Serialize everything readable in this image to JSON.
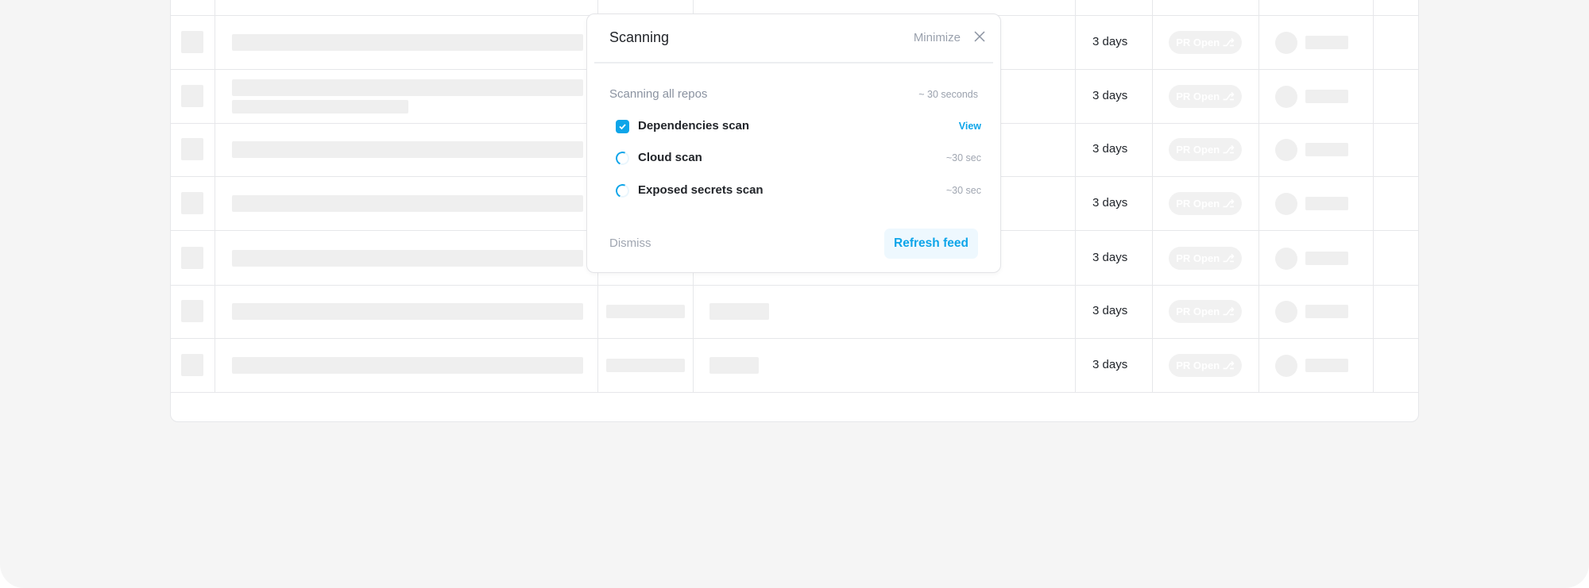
{
  "table": {
    "rows": [
      {
        "age": "3 days",
        "status": "PR Open ⎇"
      },
      {
        "age": "3 days",
        "status": "PR Open ⎇"
      },
      {
        "age": "3 days",
        "status": "PR Open ⎇"
      },
      {
        "age": "3 days",
        "status": "PR Open ⎇"
      },
      {
        "age": "3 days",
        "status": "PR Open ⎇"
      },
      {
        "age": "3 days",
        "status": "PR Open ⎇"
      },
      {
        "age": "3 days",
        "status": "PR Open ⎇"
      }
    ]
  },
  "popup": {
    "title": "Scanning",
    "minimize": "Minimize",
    "subtitle": "Scanning all repos",
    "eta": "~ 30 seconds",
    "items": [
      {
        "label": "Dependencies scan",
        "right": "View",
        "state": "done"
      },
      {
        "label": "Cloud scan",
        "right": "~30 sec",
        "state": "loading"
      },
      {
        "label": "Exposed secrets scan",
        "right": "~30 sec",
        "state": "loading"
      }
    ],
    "dismiss": "Dismiss",
    "refresh": "Refresh feed"
  },
  "colors": {
    "accent": "#0ea5e9",
    "background": "#f5f5f5"
  }
}
